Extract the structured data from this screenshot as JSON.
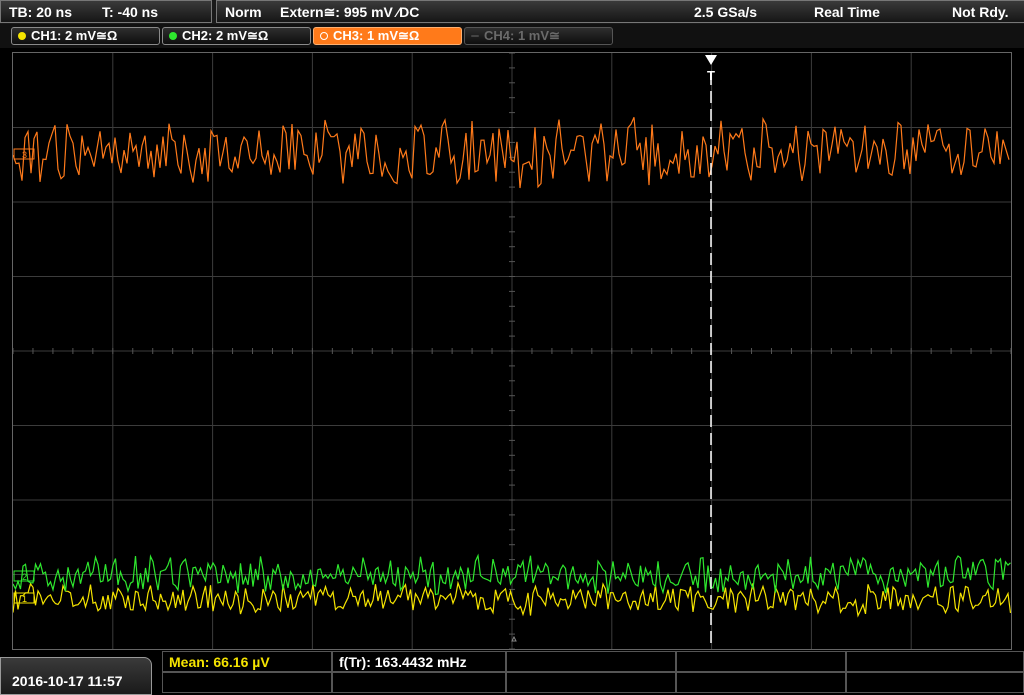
{
  "header": {
    "timebase": "TB: 20 ns",
    "trigger_offset": "T: -40 ns",
    "trigger_mode": "Norm",
    "trigger_source": "Extern≅: 995 mV ⁄DC",
    "sample_rate": "2.5 GSa/s",
    "acquisition_mode": "Real Time",
    "status": "Not Rdy."
  },
  "channels": [
    {
      "label": "CH1: 2 mV≅Ω",
      "color": "#f5e400",
      "state": "on"
    },
    {
      "label": "CH2: 2 mV≅Ω",
      "color": "#2ee82e",
      "state": "on"
    },
    {
      "label": "CH3: 1 mV≅Ω",
      "color": "#ff7a1a",
      "state": "selected"
    },
    {
      "label": "CH4: 1 mV≅",
      "color": "#6a6a6a",
      "state": "off"
    }
  ],
  "screen": {
    "trigger_marker": "T",
    "ch3_marker": "3",
    "ch2_marker": "2",
    "ch1_marker": "1"
  },
  "footer": {
    "datetime": "2016-10-17 11:57",
    "mean_label": "Mean: 66.16 µV",
    "freq_label": "f(Tr): 163.4432 mHz"
  },
  "colors": {
    "ch1": "#f5e400",
    "ch2": "#2ee82e",
    "ch3": "#ff7a1a",
    "grid": "#3c3c3c",
    "measure_highlight": "#f5e400"
  }
}
